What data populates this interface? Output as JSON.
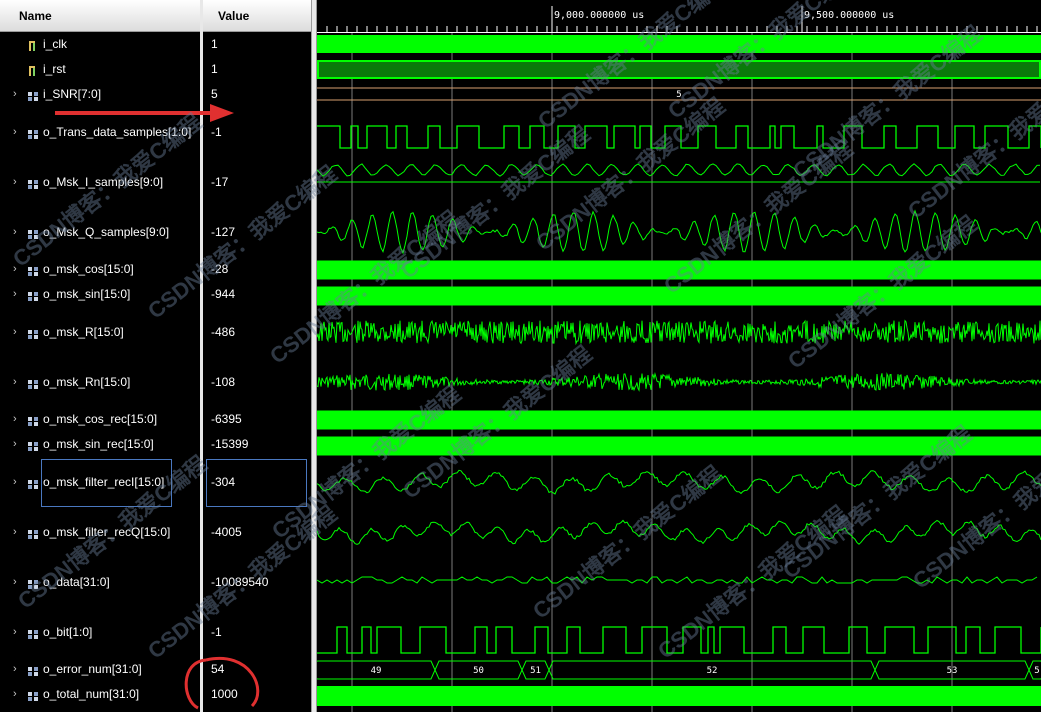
{
  "header": {
    "name_label": "Name",
    "value_label": "Value"
  },
  "signals": [
    {
      "name": "i_clk",
      "value": "1",
      "icon": "bit-signal-icon",
      "expandable": false
    },
    {
      "name": "i_rst",
      "value": "1",
      "icon": "bit-signal-icon",
      "expandable": false
    },
    {
      "name": "i_SNR[7:0]",
      "value": "5",
      "icon": "bus-signal-icon",
      "expandable": true
    },
    {
      "name": "o_Trans_data_samples[1:0]",
      "value": "-1",
      "icon": "bus-signal-icon",
      "expandable": true
    },
    {
      "name": "o_Msk_I_samples[9:0]",
      "value": "-17",
      "icon": "bus-signal-icon",
      "expandable": true
    },
    {
      "name": "o_Msk_Q_samples[9:0]",
      "value": "-127",
      "icon": "bus-signal-icon",
      "expandable": true
    },
    {
      "name": "o_msk_cos[15:0]",
      "value": "-28",
      "icon": "bus-signal-icon",
      "expandable": true
    },
    {
      "name": "o_msk_sin[15:0]",
      "value": "-944",
      "icon": "bus-signal-icon",
      "expandable": true
    },
    {
      "name": "o_msk_R[15:0]",
      "value": "-486",
      "icon": "bus-signal-icon",
      "expandable": true
    },
    {
      "name": "o_msk_Rn[15:0]",
      "value": "-108",
      "icon": "bus-signal-icon",
      "expandable": true
    },
    {
      "name": "o_msk_cos_rec[15:0]",
      "value": "-6395",
      "icon": "bus-signal-icon",
      "expandable": true
    },
    {
      "name": "o_msk_sin_rec[15:0]",
      "value": "-15399",
      "icon": "bus-signal-icon",
      "expandable": true
    },
    {
      "name": "o_msk_filter_recI[15:0]",
      "value": "-304",
      "icon": "bus-signal-icon",
      "expandable": true
    },
    {
      "name": "o_msk_filter_recQ[15:0]",
      "value": "-4005",
      "icon": "bus-signal-icon",
      "expandable": true
    },
    {
      "name": "o_data[31:0]",
      "value": "-10089540",
      "icon": "bus-signal-icon",
      "expandable": true
    },
    {
      "name": "o_bit[1:0]",
      "value": "-1",
      "icon": "bus-signal-icon",
      "expandable": true
    },
    {
      "name": "o_error_num[31:0]",
      "value": "54",
      "icon": "bus-signal-icon",
      "expandable": true
    },
    {
      "name": "o_total_num[31:0]",
      "value": "1000",
      "icon": "bus-signal-icon",
      "expandable": true
    }
  ],
  "timeline": {
    "markers": [
      "9,000.000000 us",
      "9,500.000000 us"
    ]
  },
  "bus_labels": {
    "snr": "5",
    "error_num": [
      "49",
      "50",
      "51",
      "52",
      "53",
      "5"
    ]
  },
  "watermark": {
    "text": "CSDN博客：我爱C编程"
  },
  "colors": {
    "wave": "#00ff00",
    "wave_dim": "#0a7a0a",
    "bus_line": "#d8a070",
    "grid": "#9a9a9a",
    "annotation_red": "#e03030",
    "selection": "#4a78c0"
  }
}
